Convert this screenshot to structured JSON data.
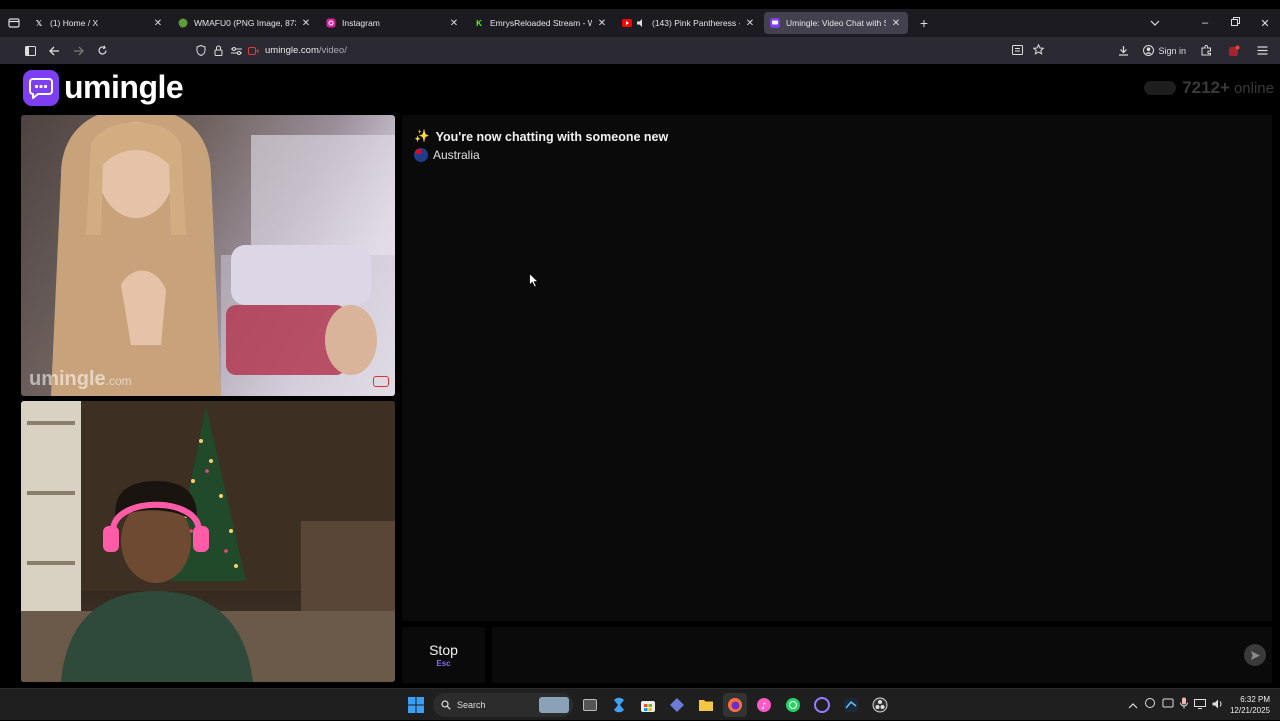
{
  "browser": {
    "tabs": [
      {
        "title": "(1) Home / X",
        "icon": "x-logo-icon",
        "active": false
      },
      {
        "title": "WMAFU0 (PNG Image, 873 × 1",
        "icon": "image-frog-icon",
        "active": false
      },
      {
        "title": "Instagram",
        "icon": "instagram-icon",
        "active": false
      },
      {
        "title": "EmrysReloaded Stream - Watch",
        "icon": "kick-icon",
        "active": false
      },
      {
        "title": "(143) Pink Pantheress - Pai",
        "icon": "youtube-icon",
        "active": false
      },
      {
        "title": "Umingle: Video Chat with S",
        "icon": "umingle-icon",
        "active": true
      }
    ],
    "url_host": "umingle.com",
    "url_path": "/video/",
    "signin_label": "Sign in"
  },
  "page": {
    "logo_text": "umingle",
    "online_count": "7212+",
    "online_label": "online",
    "remote_watermark": "umingle",
    "remote_watermark_suffix": ".com",
    "chat": {
      "status_emoji": "✨",
      "status_message": "You're now chatting with someone new",
      "country": "Australia"
    },
    "stop_label": "Stop",
    "stop_key": "Esc",
    "message_placeholder": ""
  },
  "taskbar": {
    "search_label": "Search",
    "time": "6:32 PM",
    "date": "12/21/2025"
  }
}
